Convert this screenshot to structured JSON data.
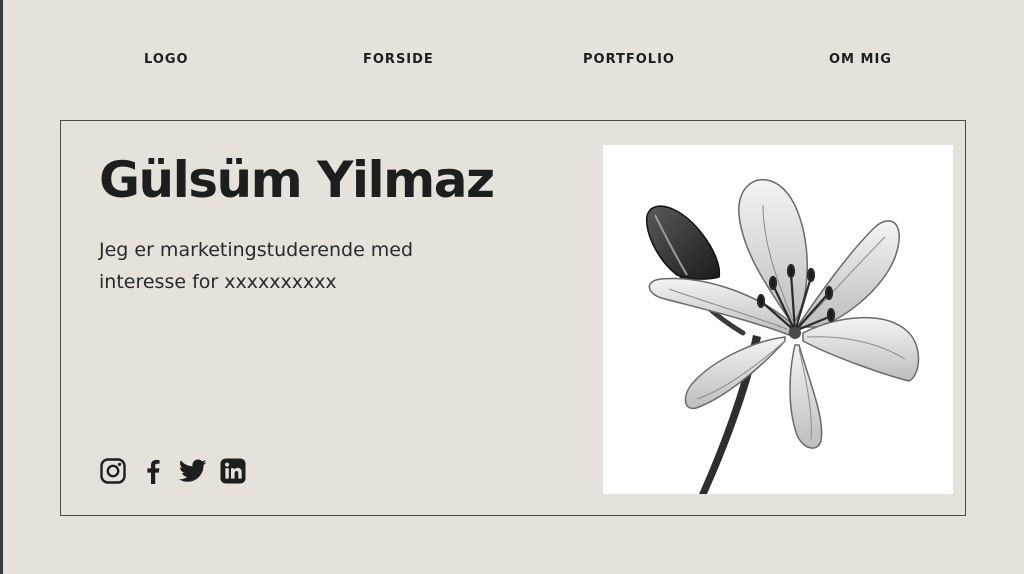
{
  "nav": {
    "items": [
      {
        "label": "LOGO"
      },
      {
        "label": "FORSIDE"
      },
      {
        "label": "PORTFOLIO"
      },
      {
        "label": "OM MIG"
      }
    ]
  },
  "hero": {
    "name": "Gülsüm Yilmaz",
    "bio_line1": "Jeg er marketingstuderende med",
    "bio_line2": "interesse for xxxxxxxxxx"
  },
  "social": {
    "icons": [
      "instagram-icon",
      "facebook-icon",
      "twitter-icon",
      "linkedin-icon"
    ]
  },
  "photo": {
    "subject": "black-and-white lily flower",
    "background": "#ffffff"
  },
  "colors": {
    "page_background": "#e6e1db",
    "text": "#1e1e1e",
    "card_border": "#4a4a4a"
  }
}
